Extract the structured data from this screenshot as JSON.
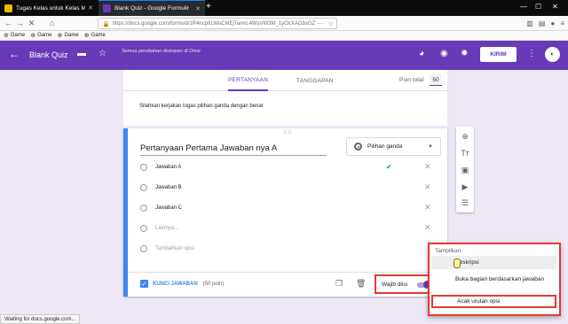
{
  "browser": {
    "tabs": [
      {
        "title": "Tugas Kelas untuk Kelas Maya",
        "favicon_color": "#f4b400"
      },
      {
        "title": "Blank Quiz - Google Formulir",
        "favicon_color": "#673ab7"
      }
    ],
    "new_tab": "+",
    "window_controls": [
      "—",
      "☐",
      "✕"
    ],
    "url": "https://docs.google.com/forms/d/1R4ncp8LWoCMEjTamrL4WsVW3M_1yOvXAGbsGZ",
    "bookmarks": [
      "Game",
      "Game",
      "Game",
      "Game"
    ]
  },
  "header": {
    "title": "Blank Quiz",
    "saved_notice": "Semua perubahan disimpan di Drive",
    "send_label": "KIRIM",
    "accent": "#673ab7"
  },
  "tabs": {
    "questions": "PERTANYAAN",
    "responses": "TANGGAPAN",
    "points_label": "Poin total:",
    "points_value": "50"
  },
  "description": "Silahkan kerjakan tugas pilihan ganda dengan benar",
  "question": {
    "title": "Pertanyaan Pertama Jawaban nya A",
    "type_label": "Pilihan ganda",
    "options": [
      {
        "label": "Jawaban A",
        "correct": true
      },
      {
        "label": "Jawaban B"
      },
      {
        "label": "Jawaban C"
      },
      {
        "label": "Lainnya..."
      },
      {
        "label": "Tambahkan opsi"
      }
    ],
    "answer_key_label": "KUNCI JAWABAN",
    "answer_points": "(50 poin)",
    "required_label": "Wajib diisi"
  },
  "menu": {
    "header": "Tampilkan",
    "items": [
      "Deskripsi",
      "Buka bagian berdasarkan jawaban",
      "Acak urutan opsi"
    ]
  },
  "status_text": "Waiting for docs.google.com..."
}
